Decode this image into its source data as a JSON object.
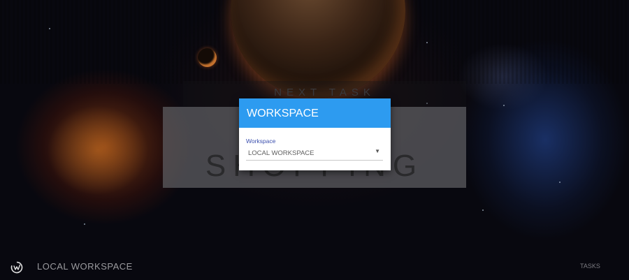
{
  "background_task": {
    "heading": "NEXT TASK",
    "title": "SHOPPING"
  },
  "modal": {
    "title": "WORKSPACE",
    "field_label": "Workspace",
    "selected_value": "LOCAL WORKSPACE",
    "arrow_glyph": "▼"
  },
  "footer": {
    "workspace_name": "LOCAL WORKSPACE",
    "tasks_link": "TASKS"
  },
  "colors": {
    "modal_header": "#2d9bf0",
    "field_label": "#3b4fae",
    "background": "#08080f"
  },
  "icons": {
    "logo": "app-logo-icon",
    "dropdown": "dropdown-arrow-icon"
  }
}
